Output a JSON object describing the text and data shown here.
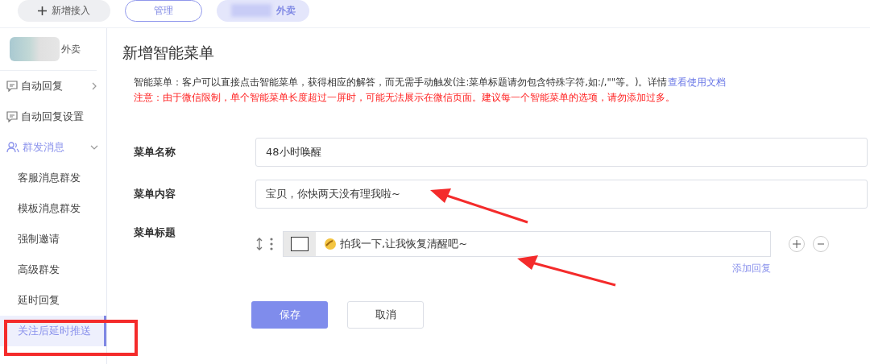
{
  "top_tabs": [
    {
      "label": "新增接入",
      "kind": "add",
      "selected": false
    },
    {
      "label": "管理",
      "kind": "outline",
      "selected": false
    },
    {
      "label": "外卖",
      "kind": "blurred",
      "selected": true
    }
  ],
  "account": {
    "name": "外卖"
  },
  "sidebar": {
    "items": [
      {
        "label": "自动回复",
        "kind": "chat",
        "expanded": false,
        "selected": false
      },
      {
        "label": "自动回复设置",
        "kind": "chat",
        "selected": false
      },
      {
        "label": "群发消息",
        "kind": "group",
        "expanded": true,
        "selected": false,
        "children": [
          {
            "label": "客服消息群发",
            "selected": false
          },
          {
            "label": "模板消息群发",
            "selected": false
          },
          {
            "label": "强制邀请",
            "selected": false
          },
          {
            "label": "高级群发",
            "selected": false
          },
          {
            "label": "延时回复",
            "selected": false
          },
          {
            "label": "关注后延时推送",
            "selected": true
          }
        ]
      }
    ]
  },
  "page": {
    "title": "新增智能菜单",
    "intro": {
      "text": "智能菜单：客户可以直接点击智能菜单，获得相应的解答，而无需手动触发(注:菜单标题请勿包含特殊字符,如:/,\"\"等。)。详情",
      "link": "查看使用文档"
    },
    "warning": "注意：由于微信限制，单个智能菜单长度超过一屏时，可能无法展示在微信页面。建议每一个智能菜单的选项，请勿添加过多。",
    "form": {
      "name": {
        "label": "菜单名称",
        "value": "48小时唤醒"
      },
      "content": {
        "label": "菜单内容",
        "value": "宝贝，你快两天没有理我啦~"
      },
      "titles": {
        "label": "菜单标题",
        "items": [
          {
            "value": "拍我一下,让我恢复清醒吧~"
          }
        ],
        "add_link": "添加回复"
      }
    },
    "buttons": [
      {
        "label": "保存",
        "kind": "primary"
      },
      {
        "label": "取消",
        "kind": "default"
      }
    ]
  }
}
